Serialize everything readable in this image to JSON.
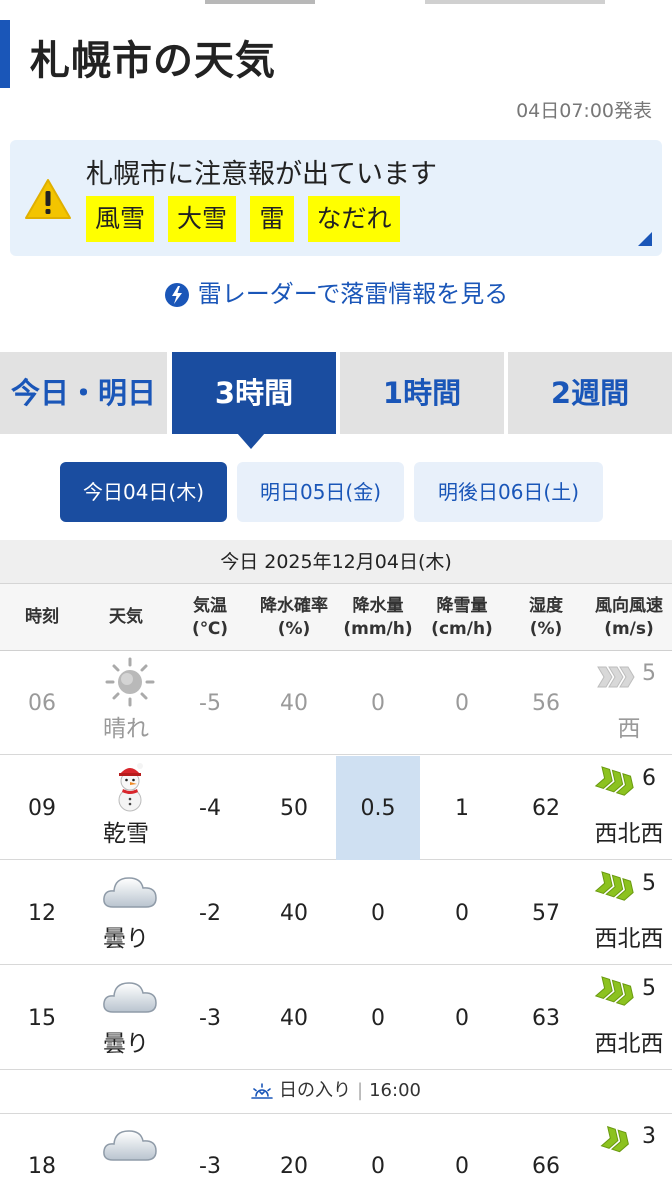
{
  "header": {
    "title": "札幌市の天気",
    "issued": "04日07:00発表"
  },
  "alert": {
    "message": "札幌市に注意報が出ています",
    "tags": [
      "風雪",
      "大雪",
      "雷",
      "なだれ"
    ]
  },
  "radar_link": "雷レーダーで落雷情報を見る",
  "tabs": [
    {
      "label": "今日・明日"
    },
    {
      "label": "3時間"
    },
    {
      "label": "1時間"
    },
    {
      "label": "2週間"
    }
  ],
  "active_tab": "3時間",
  "days": [
    {
      "label": "今日04日(木)"
    },
    {
      "label": "明日05日(金)"
    },
    {
      "label": "明後日06日(土)"
    }
  ],
  "date_bar": "今日 2025年12月04日(木)",
  "table": {
    "headers": [
      {
        "l1": "時刻",
        "l2": ""
      },
      {
        "l1": "天気",
        "l2": ""
      },
      {
        "l1": "気温",
        "l2": "(℃)"
      },
      {
        "l1": "降水確率",
        "l2": "(%)"
      },
      {
        "l1": "降水量",
        "l2": "(mm/h)"
      },
      {
        "l1": "降雪量",
        "l2": "(cm/h)"
      },
      {
        "l1": "湿度",
        "l2": "(%)"
      },
      {
        "l1": "風向風速",
        "l2": "(m/s)"
      }
    ],
    "rows": [
      {
        "time": "06",
        "weather": "晴れ",
        "icon": "sun-icon",
        "temp": "-5",
        "pop": "40",
        "precip": "0",
        "snow": "0",
        "humidity": "56",
        "wind_speed": "5",
        "wind_dir": "西"
      },
      {
        "time": "09",
        "weather": "乾雪",
        "icon": "snowman-icon",
        "temp": "-4",
        "pop": "50",
        "precip": "0.5",
        "snow": "1",
        "humidity": "62",
        "wind_speed": "6",
        "wind_dir": "西北西"
      },
      {
        "time": "12",
        "weather": "曇り",
        "icon": "cloud-icon",
        "temp": "-2",
        "pop": "40",
        "precip": "0",
        "snow": "0",
        "humidity": "57",
        "wind_speed": "5",
        "wind_dir": "西北西"
      },
      {
        "time": "15",
        "weather": "曇り",
        "icon": "cloud-icon",
        "temp": "-3",
        "pop": "40",
        "precip": "0",
        "snow": "0",
        "humidity": "63",
        "wind_speed": "5",
        "wind_dir": "西北西"
      },
      {
        "time": "18",
        "weather": "",
        "icon": "cloud-icon",
        "temp": "-3",
        "pop": "20",
        "precip": "0",
        "snow": "0",
        "humidity": "66",
        "wind_speed": "3",
        "wind_dir": ""
      }
    ]
  },
  "sunset": {
    "label": "日の入り",
    "time": "16:00"
  },
  "colors": {
    "accent": "#1a56b8",
    "alert_bg": "#e7f1fb",
    "tag_bg": "#ffff00",
    "highlight": "#cfe0f2",
    "wind_arrow": "#8cc21f"
  }
}
